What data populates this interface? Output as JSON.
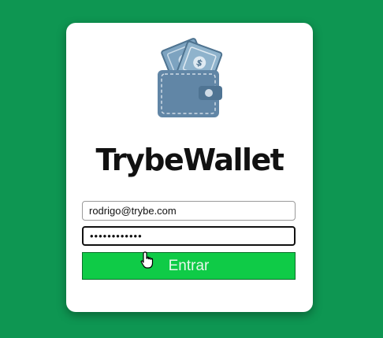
{
  "app": {
    "brand_title": "TrybeWallet"
  },
  "login_form": {
    "email_value": "rodrigo@trybe.com",
    "password_value": "••••••••••••",
    "submit_label": "Entrar"
  },
  "icons": {
    "logo": "wallet-with-cash-icon",
    "cursor": "hand-pointer-cursor-icon"
  },
  "colors": {
    "background": "#0e9652",
    "card": "#ffffff",
    "button": "#0fcb47",
    "wallet": "#6186a6",
    "cash": "#8fb3cc"
  }
}
